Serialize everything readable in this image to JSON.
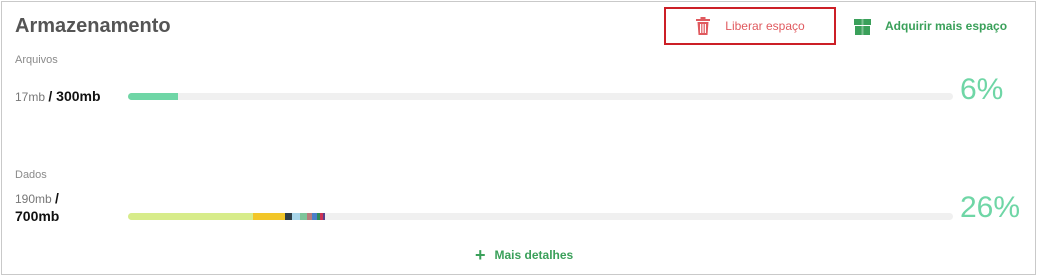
{
  "storage": {
    "title": "Armazenamento",
    "free_button_label": "Liberar espaço",
    "buy_button_label": "Adquirir mais espaço",
    "details_label": "Mais detalhes"
  },
  "files": {
    "label": "Arquivos",
    "used": "17mb",
    "total": "/ 300mb",
    "percent_label": "6%",
    "fraction": 0.06,
    "segments": [
      {
        "fraction": 0.06,
        "color": "#6fd6a6"
      }
    ]
  },
  "data": {
    "label": "Dados",
    "used": "190mb",
    "total_line1": "/",
    "total_line2": "700mb",
    "percent_label": "26%",
    "fraction": 0.26,
    "segments": [
      {
        "fraction": 0.152,
        "color": "#d7ec8a"
      },
      {
        "fraction": 0.038,
        "color": "#f2c628"
      },
      {
        "fraction": 0.009,
        "color": "#2f3e46"
      },
      {
        "fraction": 0.009,
        "color": "#a8d5e8"
      },
      {
        "fraction": 0.009,
        "color": "#7ec49a"
      },
      {
        "fraction": 0.006,
        "color": "#b97b7b"
      },
      {
        "fraction": 0.006,
        "color": "#4a7fc9"
      },
      {
        "fraction": 0.004,
        "color": "#2d8a5a"
      },
      {
        "fraction": 0.003,
        "color": "#cc3355"
      },
      {
        "fraction": 0.003,
        "color": "#5a3f8a"
      }
    ]
  },
  "colors": {
    "accent_green": "#3aa05a",
    "percent_green": "#6fd6a6",
    "danger_red": "#cc1f26"
  }
}
